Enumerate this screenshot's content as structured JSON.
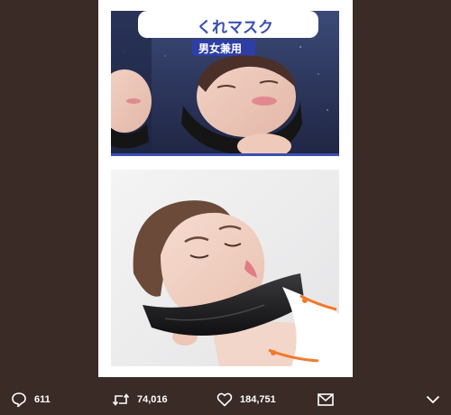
{
  "tweet": {
    "media": [
      {
        "kind": "product-package-photo",
        "package_text": [
          "くれマスク",
          "男女兼用"
        ]
      },
      {
        "kind": "person-with-tape-photo"
      }
    ],
    "actions": {
      "reply_count": "611",
      "retweet_count": "74,016",
      "like_count": "184,751"
    }
  },
  "icons": {
    "reply": "speech-bubble-icon",
    "retweet": "retweet-arrows-icon",
    "like": "heart-outline-icon",
    "dm": "envelope-icon",
    "more": "chevron-down-icon"
  },
  "colors": {
    "background": "#3a2b27",
    "card": "#ffffff",
    "action_text": "#ffffff"
  }
}
